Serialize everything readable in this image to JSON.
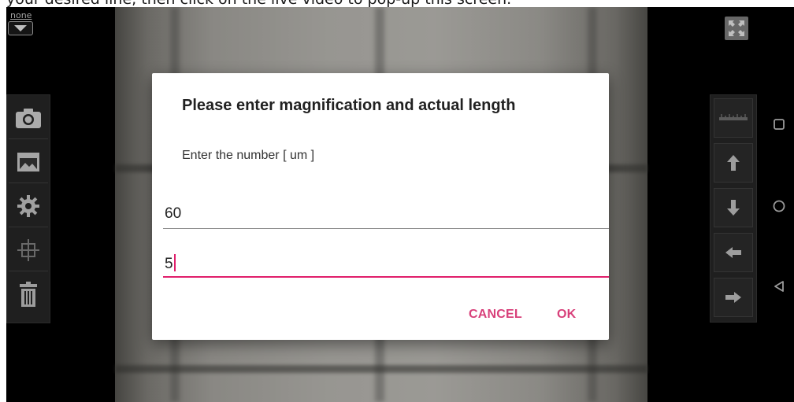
{
  "caption": {
    "text": "your desired line, then click on the live video to pop-up this screen."
  },
  "source_selector": {
    "label": "none"
  },
  "left_toolbar": {
    "items": [
      {
        "name": "camera",
        "icon": "camera-icon"
      },
      {
        "name": "gallery",
        "icon": "image-folder-icon"
      },
      {
        "name": "settings",
        "icon": "gear-icon"
      },
      {
        "name": "crosshair",
        "icon": "crosshair-icon"
      },
      {
        "name": "delete",
        "icon": "trash-icon"
      }
    ]
  },
  "right_toolbar": {
    "items": [
      {
        "name": "ruler",
        "icon": "ruler-icon"
      },
      {
        "name": "move-up",
        "icon": "arrow-up-icon"
      },
      {
        "name": "move-down",
        "icon": "arrow-down-icon"
      },
      {
        "name": "move-left",
        "icon": "arrow-left-icon"
      },
      {
        "name": "move-right",
        "icon": "arrow-right-icon"
      }
    ],
    "fullscreen_icon": "fullscreen-icon"
  },
  "nav_bar": {
    "icons": [
      "recents-icon",
      "home-icon",
      "back-icon"
    ]
  },
  "dialog": {
    "title": "Please enter magnification and actual length",
    "message": "Enter the number [ um ]",
    "magnification_value": "60",
    "length_value": "5",
    "cancel_label": "CANCEL",
    "ok_label": "OK",
    "accent_color": "#e01f6b"
  }
}
